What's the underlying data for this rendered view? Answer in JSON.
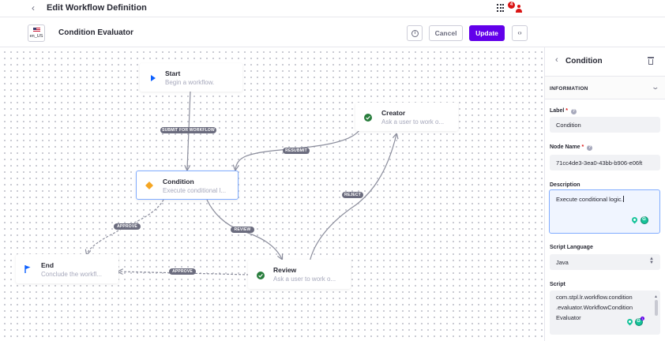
{
  "header": {
    "back_icon": "chevron-left-icon",
    "title": "Edit Workflow Definition",
    "apps_icon": "grid-icon",
    "notification_count": "4",
    "user_icon": "user-icon"
  },
  "toolbar": {
    "language_code": "en_US",
    "language_flag": "us-flag-icon",
    "definition_title": "Condition Evaluator",
    "info_icon": "info-circle-icon",
    "cancel_label": "Cancel",
    "update_label": "Update",
    "source_icon": "code-icon",
    "update_color": "#6200ea"
  },
  "canvas": {
    "nodes": [
      {
        "id": "start",
        "title": "Start",
        "description": "Begin a workflow.",
        "icon": "play-icon"
      },
      {
        "id": "creator",
        "title": "Creator",
        "description": "Ask a user to work o...",
        "icon": "check-circle-icon"
      },
      {
        "id": "condition",
        "title": "Condition",
        "description": "Execute conditional l...",
        "icon": "diamond-icon",
        "selected": true
      },
      {
        "id": "end",
        "title": "End",
        "description": "Conclude the workfl...",
        "icon": "flag-icon"
      },
      {
        "id": "review",
        "title": "Review",
        "description": "Ask a user to work o...",
        "icon": "check-circle-icon"
      }
    ],
    "transitions": [
      {
        "from": "start",
        "to": "condition",
        "label": "SUBMIT FOR WORKFLOW"
      },
      {
        "from": "creator",
        "to": "condition",
        "label": "RESUBMIT"
      },
      {
        "from": "condition",
        "to": "end",
        "label": "APPROVE"
      },
      {
        "from": "condition",
        "to": "review",
        "label": "REVIEW"
      },
      {
        "from": "review",
        "to": "creator",
        "label": "REJECT"
      },
      {
        "from": "review",
        "to": "end",
        "label": "APPROVE"
      }
    ]
  },
  "panel": {
    "back_icon": "chevron-left-icon",
    "title": "Condition",
    "delete_icon": "trash-icon",
    "section_title": "INFORMATION",
    "section_icon": "chevron-down-icon",
    "label_field": {
      "label": "Label",
      "required": "*",
      "value": "Condition"
    },
    "node_name_field": {
      "label": "Node Name",
      "required": "*",
      "value": "71cc4de3-3ea0-43bb-b906-e06ft"
    },
    "description_field": {
      "label": "Description",
      "value": "Execute conditional logic."
    },
    "script_language_field": {
      "label": "Script Language",
      "value": "Java"
    },
    "script_field": {
      "label": "Script",
      "lines": [
        "com.stpl.lr.workflow.condition",
        ".evaluator.WorkflowCondition",
        "Evaluator"
      ]
    },
    "grammarly_badge": "1"
  }
}
